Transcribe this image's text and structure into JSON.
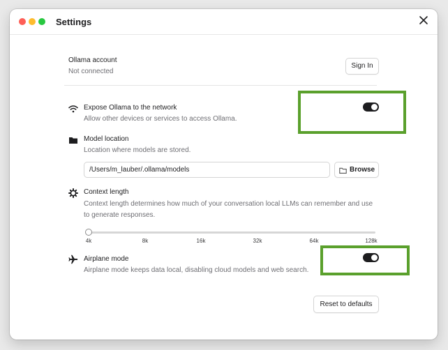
{
  "window": {
    "title": "Settings"
  },
  "account": {
    "title": "Ollama account",
    "status": "Not connected",
    "signin_label": "Sign In"
  },
  "network": {
    "title": "Expose Ollama to the network",
    "description": "Allow other devices or services to access Ollama.",
    "enabled": true
  },
  "model_location": {
    "title": "Model location",
    "description": "Location where models are stored.",
    "path": "/Users/m_lauber/.ollama/models",
    "browse_label": "Browse"
  },
  "context": {
    "title": "Context length",
    "description_line1": "Context length determines how much of your conversation local LLMs can remember and use",
    "description_line2": "to generate responses.",
    "ticks": [
      "4k",
      "8k",
      "16k",
      "32k",
      "64k",
      "128k"
    ],
    "selected": "4k"
  },
  "airplane": {
    "title": "Airplane mode",
    "description": "Airplane mode keeps data local, disabling cloud models and web search.",
    "enabled": true
  },
  "reset_label": "Reset to defaults",
  "colors": {
    "highlight": "#5aa02c",
    "toggle_on": "#1d1d1f"
  },
  "icons": {
    "network": "wifi-icon",
    "folder": "folder-icon",
    "context": "gear-icon",
    "airplane": "airplane-icon",
    "close": "close-icon"
  }
}
